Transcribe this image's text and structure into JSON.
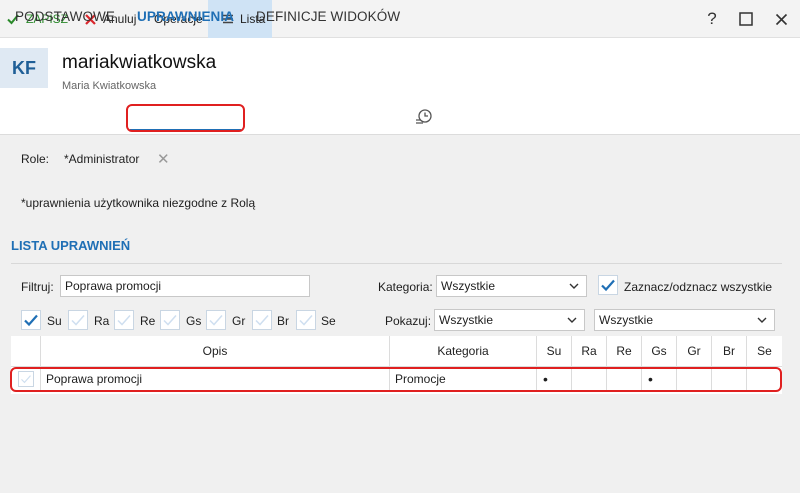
{
  "toolbar": {
    "save_label": "ZAPISZ",
    "cancel_label": "Anuluj",
    "operations_label": "Operacje",
    "list_label": "Lista",
    "help_glyph": "?",
    "maximize_glyph": "☐",
    "close_glyph": "✕"
  },
  "header": {
    "avatar_initials": "KF",
    "login": "mariakwiatkowska",
    "full_name": "Maria Kwiatkowska"
  },
  "tabs": [
    "PODSTAWOWE",
    "UPRAWNIENIA",
    "DEFINICJE WIDOKÓW"
  ],
  "active_tab": "UPRAWNIENIA",
  "role": {
    "label": "Role:",
    "value": "*Administrator",
    "remove_glyph": "✕"
  },
  "note": "*uprawnienia użytkownika niezgodne z Rolą",
  "section_title": "LISTA UPRAWNIEŃ",
  "filters": {
    "filter_label": "Filtruj:",
    "filter_value": "Poprawa promocji",
    "category_label": "Kategoria:",
    "category_value": "Wszystkie",
    "toggle_all_label": "Zaznacz/odznacz wszystkie",
    "toggle_all_checked": true,
    "show_label": "Pokazuj:",
    "show_value": "Wszystkie",
    "show_value_2": "Wszystkie",
    "checkboxes": [
      {
        "label": "Su",
        "checked": true
      },
      {
        "label": "Ra",
        "checked": false
      },
      {
        "label": "Re",
        "checked": false
      },
      {
        "label": "Gs",
        "checked": false
      },
      {
        "label": "Gr",
        "checked": false
      },
      {
        "label": "Br",
        "checked": false
      },
      {
        "label": "Se",
        "checked": false
      }
    ]
  },
  "grid": {
    "columns": [
      "Opis",
      "Kategoria",
      "Su",
      "Ra",
      "Re",
      "Gs",
      "Gr",
      "Br",
      "Se"
    ],
    "rows": [
      {
        "checked": false,
        "opis": "Poprawa promocji",
        "kategoria": "Promocje",
        "su": "•",
        "ra": "",
        "re": "",
        "gs": "•",
        "gr": "",
        "br": "",
        "se": ""
      }
    ]
  },
  "colors": {
    "accent": "#1f6fb5",
    "save_green": "#2b8a2b",
    "cancel_red": "#d9262b",
    "highlight_red": "#e02020",
    "active_toolbar": "#cfe3f5"
  }
}
